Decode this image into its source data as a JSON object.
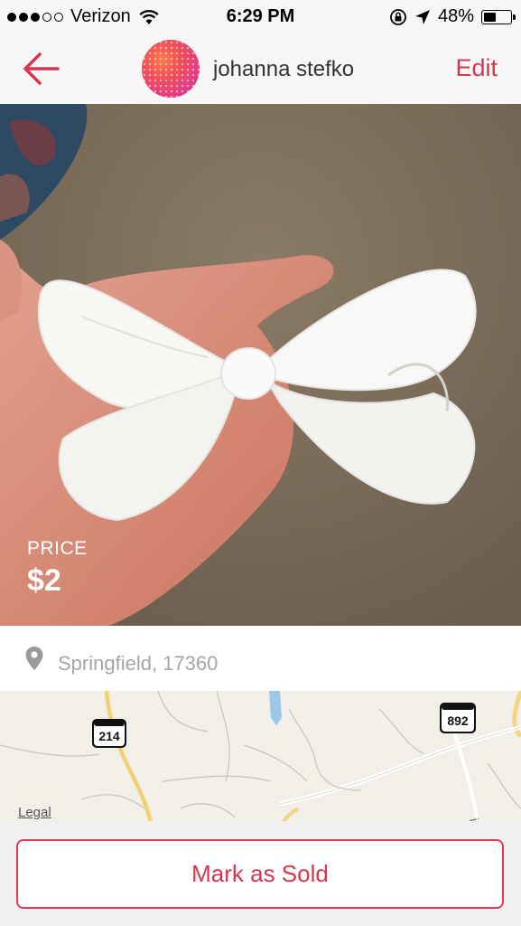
{
  "status_bar": {
    "carrier": "Verizon",
    "signal_bars_filled": 3,
    "signal_bars_total": 5,
    "time": "6:29 PM",
    "battery_percent": "48%",
    "battery_level": 0.48
  },
  "nav": {
    "back_icon": "back-arrow-icon",
    "seller_name": "johanna stefko",
    "edit_label": "Edit",
    "accent_color": "#d6364f"
  },
  "listing": {
    "price_label": "PRICE",
    "price_value": "$2"
  },
  "location": {
    "icon": "location-pin-icon",
    "text": "Springfield, 17360"
  },
  "map": {
    "road_shields": [
      "214",
      "892"
    ],
    "street_label": "in St",
    "legal_label": "Legal"
  },
  "actions": {
    "mark_sold_label": "Mark as Sold",
    "button_color": "#e63a57"
  }
}
